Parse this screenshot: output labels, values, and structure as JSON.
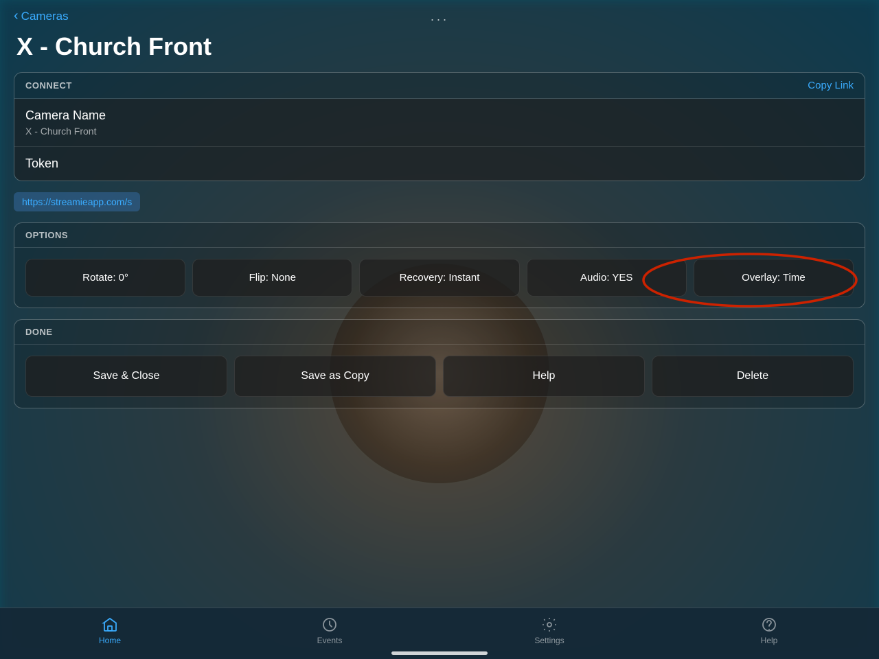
{
  "nav": {
    "back_label": "Cameras",
    "three_dots": "···"
  },
  "page": {
    "title": "X - Church Front"
  },
  "connect_section": {
    "header": "CONNECT",
    "copy_link_label": "Copy Link",
    "camera_name_label": "Camera Name",
    "camera_name_value": "X - Church Front",
    "token_label": "Token",
    "token_value": "",
    "url": "https://streamieapp.com/s"
  },
  "options_section": {
    "header": "OPTIONS",
    "buttons": [
      {
        "label": "Rotate: 0°",
        "id": "rotate"
      },
      {
        "label": "Flip: None",
        "id": "flip"
      },
      {
        "label": "Recovery: Instant",
        "id": "recovery"
      },
      {
        "label": "Audio: YES",
        "id": "audio"
      },
      {
        "label": "Overlay: Time",
        "id": "overlay"
      }
    ]
  },
  "done_section": {
    "header": "DONE",
    "buttons": [
      {
        "label": "Save & Close",
        "id": "save-close"
      },
      {
        "label": "Save as Copy",
        "id": "save-copy"
      },
      {
        "label": "Help",
        "id": "help"
      },
      {
        "label": "Delete",
        "id": "delete"
      }
    ]
  },
  "tab_bar": {
    "items": [
      {
        "label": "Home",
        "icon": "home",
        "active": true
      },
      {
        "label": "Events",
        "icon": "events",
        "active": false
      },
      {
        "label": "Settings",
        "icon": "settings",
        "active": false
      },
      {
        "label": "Help",
        "icon": "help",
        "active": false
      }
    ]
  }
}
